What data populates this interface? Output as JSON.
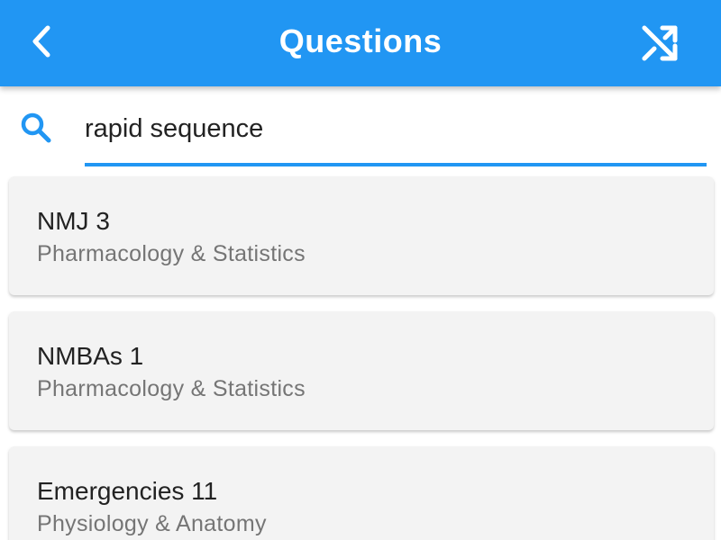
{
  "appbar": {
    "title": "Questions",
    "back_icon": "chevron-left-icon",
    "shuffle_icon": "shuffle-icon",
    "color": "#2196f3"
  },
  "search": {
    "icon": "search-icon",
    "value": "rapid sequence",
    "placeholder": ""
  },
  "results": [
    {
      "title": "NMJ 3",
      "subtitle": "Pharmacology & Statistics"
    },
    {
      "title": "NMBAs 1",
      "subtitle": "Pharmacology & Statistics"
    },
    {
      "title": "Emergencies 11",
      "subtitle": "Physiology & Anatomy"
    }
  ]
}
